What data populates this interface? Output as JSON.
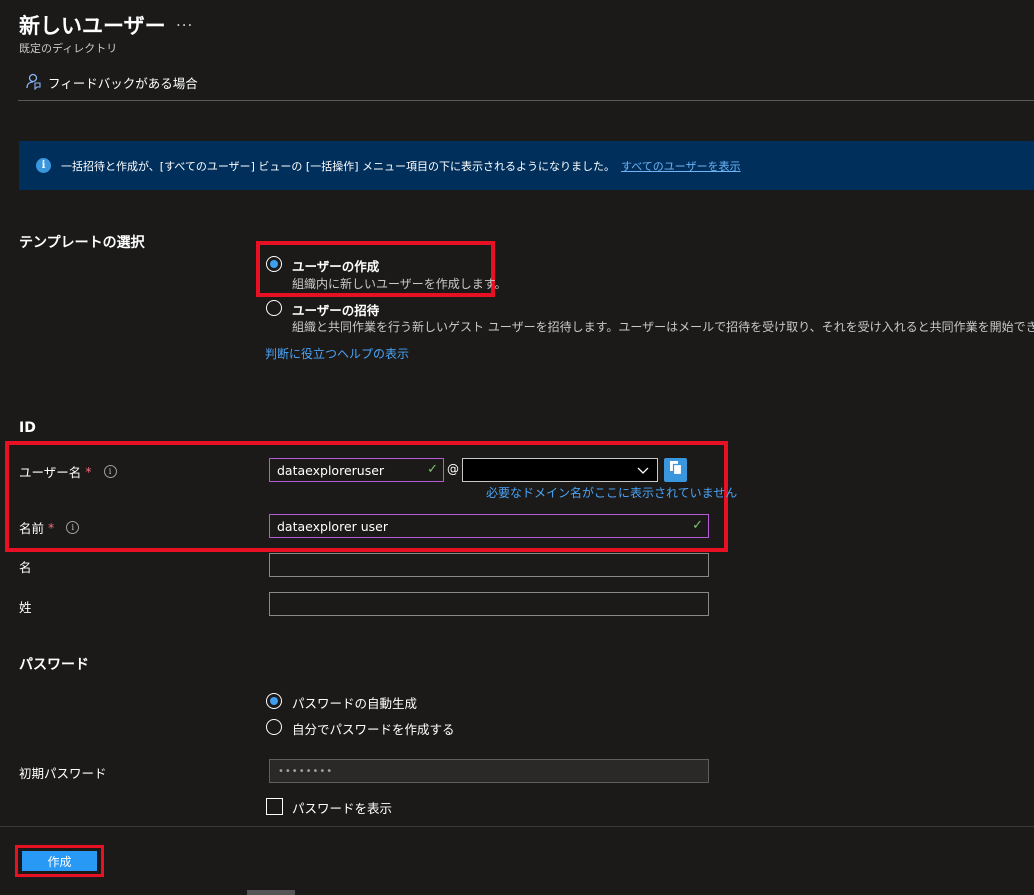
{
  "header": {
    "title": "新しいユーザー",
    "more": "...",
    "subtitle": "既定のディレクトリ",
    "feedback": "フィードバックがある場合"
  },
  "infobar": {
    "text": "一括招待と作成が、[すべてのユーザー] ビューの [一括操作] メニュー項目の下に表示されるようになりました。",
    "link": "すべてのユーザーを表示"
  },
  "template": {
    "heading": "テンプレートの選択",
    "options": [
      {
        "label": "ユーザーの作成",
        "desc": "組織内に新しいユーザーを作成します。",
        "checked": true
      },
      {
        "label": "ユーザーの招待",
        "desc": "組織と共同作業を行う新しいゲスト ユーザーを招待します。ユーザーはメールで招待を受け取り、それを受け入れると共同作業を開始できます。",
        "checked": false
      }
    ],
    "help_link": "判断に役立つヘルプの表示"
  },
  "identity": {
    "heading": "ID",
    "username_label": "ユーザー名",
    "username_value": "dataexploreruser",
    "at": "@",
    "domain_warning": "必要なドメイン名がここに表示されていません",
    "name_label": "名前",
    "name_value": "dataexplorer user",
    "given_name_label": "名",
    "surname_label": "姓",
    "required_mark": "*",
    "info_glyph": "i"
  },
  "password": {
    "heading": "パスワード",
    "options": [
      {
        "label": "パスワードの自動生成",
        "checked": true
      },
      {
        "label": "自分でパスワードを作成する",
        "checked": false
      }
    ],
    "initial_label": "初期パスワード",
    "initial_value": "••••••••",
    "show_label": "パスワードを表示"
  },
  "footer": {
    "create_label": "作成"
  },
  "colors": {
    "background": "#1b1a19",
    "accent": "#2899f5",
    "highlight_border": "#e81123",
    "link": "#4aa3f5"
  }
}
